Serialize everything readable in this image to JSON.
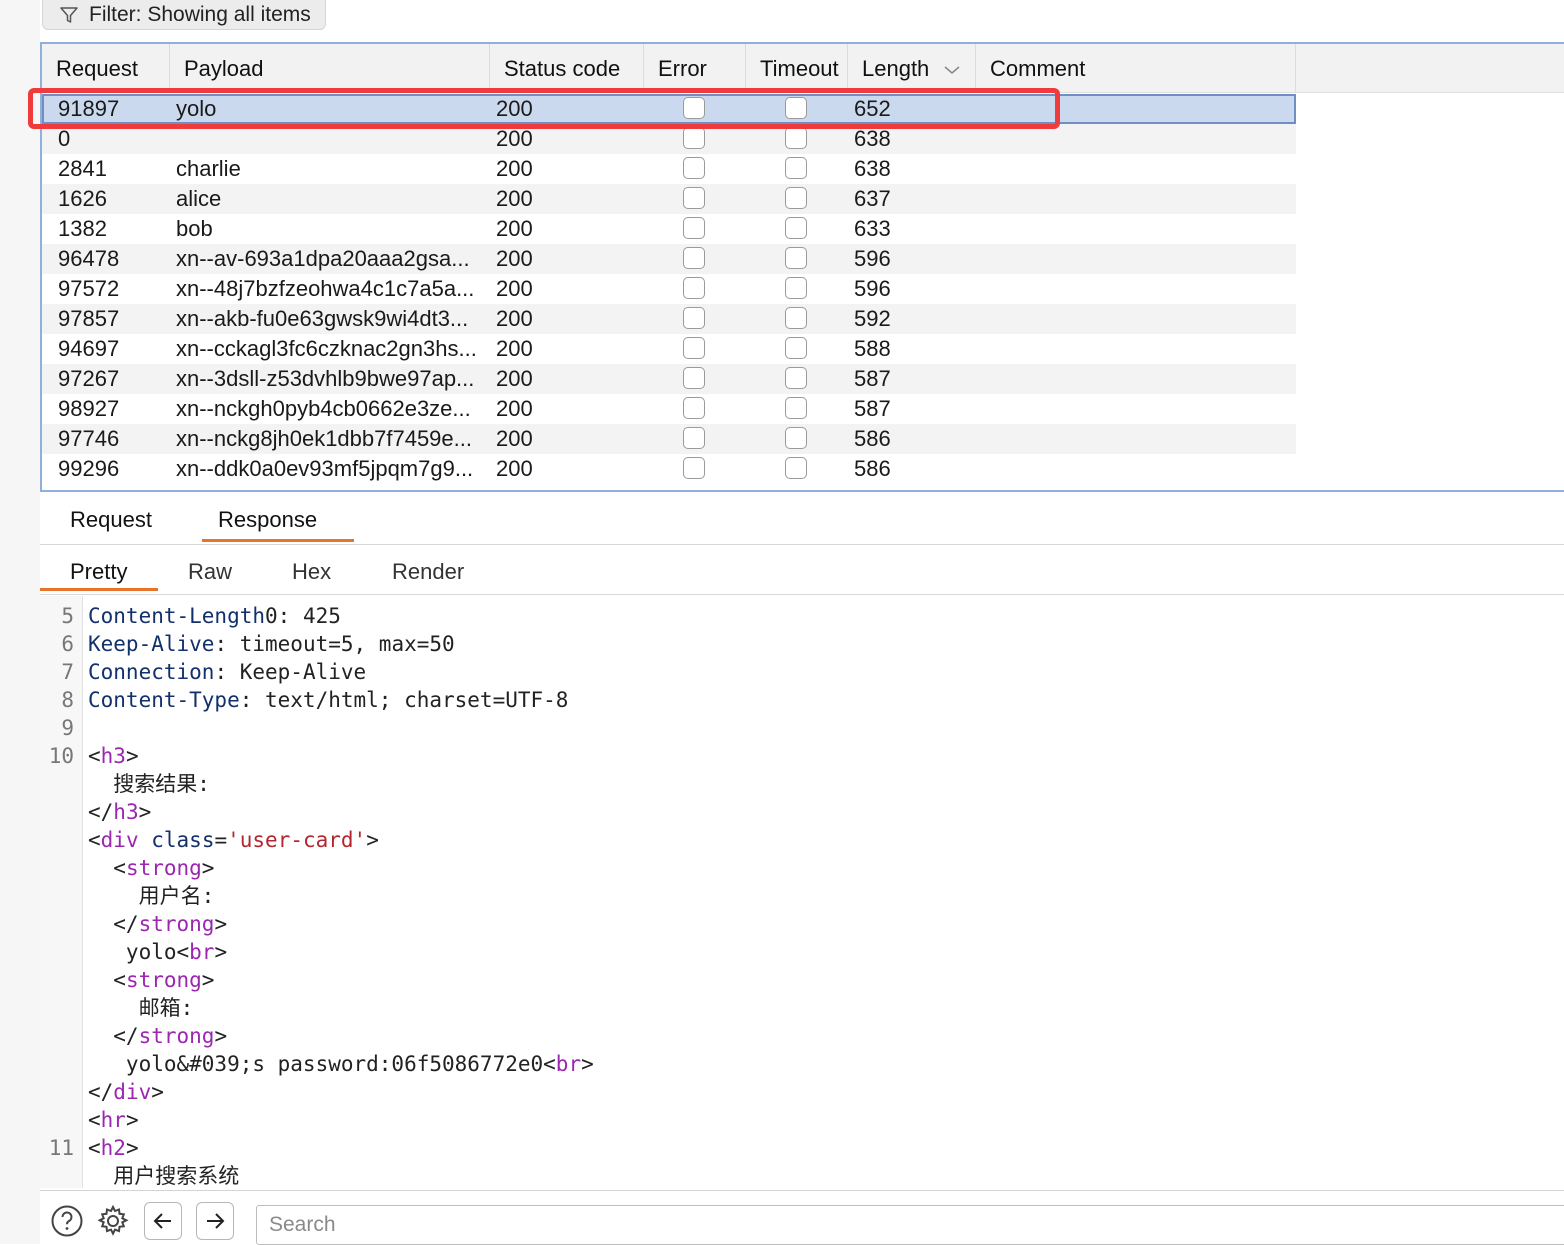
{
  "filter": {
    "label": "Filter: Showing all items"
  },
  "table": {
    "columns": [
      "Request",
      "Payload",
      "Status code",
      "Error",
      "Timeout",
      "Length",
      "Comment"
    ],
    "rows": [
      {
        "request": "91897",
        "payload": "yolo",
        "status": "200",
        "length": "652",
        "selected": true
      },
      {
        "request": "0",
        "payload": "",
        "status": "200",
        "length": "638"
      },
      {
        "request": "2841",
        "payload": "charlie",
        "status": "200",
        "length": "638"
      },
      {
        "request": "1626",
        "payload": "alice",
        "status": "200",
        "length": "637"
      },
      {
        "request": "1382",
        "payload": "bob",
        "status": "200",
        "length": "633"
      },
      {
        "request": "96478",
        "payload": "xn--av-693a1dpa20aaa2gsa...",
        "status": "200",
        "length": "596"
      },
      {
        "request": "97572",
        "payload": "xn--48j7bzfzeohwa4c1c7a5a...",
        "status": "200",
        "length": "596"
      },
      {
        "request": "97857",
        "payload": "xn--akb-fu0e63gwsk9wi4dt3...",
        "status": "200",
        "length": "592"
      },
      {
        "request": "94697",
        "payload": "xn--cckagl3fc6czknac2gn3hs...",
        "status": "200",
        "length": "588"
      },
      {
        "request": "97267",
        "payload": "xn--3dsll-z53dvhlb9bwe97ap...",
        "status": "200",
        "length": "587"
      },
      {
        "request": "98927",
        "payload": "xn--nckgh0pyb4cb0662e3ze...",
        "status": "200",
        "length": "587"
      },
      {
        "request": "97746",
        "payload": "xn--nckg8jh0ek1dbb7f7459e...",
        "status": "200",
        "length": "586"
      },
      {
        "request": "99296",
        "payload": "xn--ddk0a0ev93mf5jpqm7g9...",
        "status": "200",
        "length": "586"
      }
    ]
  },
  "tabs": {
    "request": "Request",
    "response": "Response"
  },
  "subtabs": {
    "pretty": "Pretty",
    "raw": "Raw",
    "hex": "Hex",
    "render": "Render"
  },
  "code": {
    "lines": [
      {
        "n": "5",
        "tokens": [
          [
            "hk",
            "Content-Length"
          ],
          [
            "",
            "0: 425"
          ]
        ]
      },
      {
        "n": "6",
        "tokens": [
          [
            "hk",
            "Keep-Alive"
          ],
          [
            "",
            ": timeout=5, max=50"
          ]
        ]
      },
      {
        "n": "7",
        "tokens": [
          [
            "hk",
            "Connection"
          ],
          [
            "",
            ": Keep-Alive"
          ]
        ]
      },
      {
        "n": "8",
        "tokens": [
          [
            "hk",
            "Content-Type"
          ],
          [
            "",
            ": text/html; charset=UTF-8"
          ]
        ]
      },
      {
        "n": "9",
        "tokens": []
      },
      {
        "n": "10",
        "tokens": [
          [
            "",
            "<"
          ],
          [
            "tag",
            "h3"
          ],
          [
            "",
            ">"
          ]
        ]
      },
      {
        "n": "",
        "tokens": [
          [
            "",
            "  搜索结果:"
          ]
        ]
      },
      {
        "n": "",
        "tokens": [
          [
            "",
            "</"
          ],
          [
            "tag",
            "h3"
          ],
          [
            "",
            ">"
          ]
        ]
      },
      {
        "n": "",
        "tokens": [
          [
            "",
            "<"
          ],
          [
            "tag",
            "div"
          ],
          [
            "",
            " "
          ],
          [
            "attr",
            "class"
          ],
          [
            "",
            "="
          ],
          [
            "str",
            "'user-card'"
          ],
          [
            "",
            ">"
          ]
        ]
      },
      {
        "n": "",
        "tokens": [
          [
            "",
            "  <"
          ],
          [
            "tag",
            "strong"
          ],
          [
            "",
            ">"
          ]
        ]
      },
      {
        "n": "",
        "tokens": [
          [
            "",
            "    用户名:"
          ]
        ]
      },
      {
        "n": "",
        "tokens": [
          [
            "",
            "  </"
          ],
          [
            "tag",
            "strong"
          ],
          [
            "",
            ">"
          ]
        ]
      },
      {
        "n": "",
        "tokens": [
          [
            "",
            "   yolo<"
          ],
          [
            "tag",
            "br"
          ],
          [
            "",
            ">"
          ]
        ]
      },
      {
        "n": "",
        "tokens": [
          [
            "",
            "  <"
          ],
          [
            "tag",
            "strong"
          ],
          [
            "",
            ">"
          ]
        ]
      },
      {
        "n": "",
        "tokens": [
          [
            "",
            "    邮箱:"
          ]
        ]
      },
      {
        "n": "",
        "tokens": [
          [
            "",
            "  </"
          ],
          [
            "tag",
            "strong"
          ],
          [
            "",
            ">"
          ]
        ]
      },
      {
        "n": "",
        "tokens": [
          [
            "",
            "   yolo&#039;s password:06f5086772e0<"
          ],
          [
            "tag",
            "br"
          ],
          [
            "",
            ">"
          ]
        ]
      },
      {
        "n": "",
        "tokens": [
          [
            "",
            "</"
          ],
          [
            "tag",
            "div"
          ],
          [
            "",
            ">"
          ]
        ]
      },
      {
        "n": "",
        "tokens": [
          [
            "",
            "<"
          ],
          [
            "tag",
            "hr"
          ],
          [
            "",
            ">"
          ]
        ]
      },
      {
        "n": "11",
        "tokens": [
          [
            "",
            "<"
          ],
          [
            "tag",
            "h2"
          ],
          [
            "",
            ">"
          ]
        ]
      },
      {
        "n": "",
        "tokens": [
          [
            "",
            "  用户搜索系统"
          ]
        ]
      }
    ]
  },
  "search": {
    "placeholder": "Search"
  }
}
